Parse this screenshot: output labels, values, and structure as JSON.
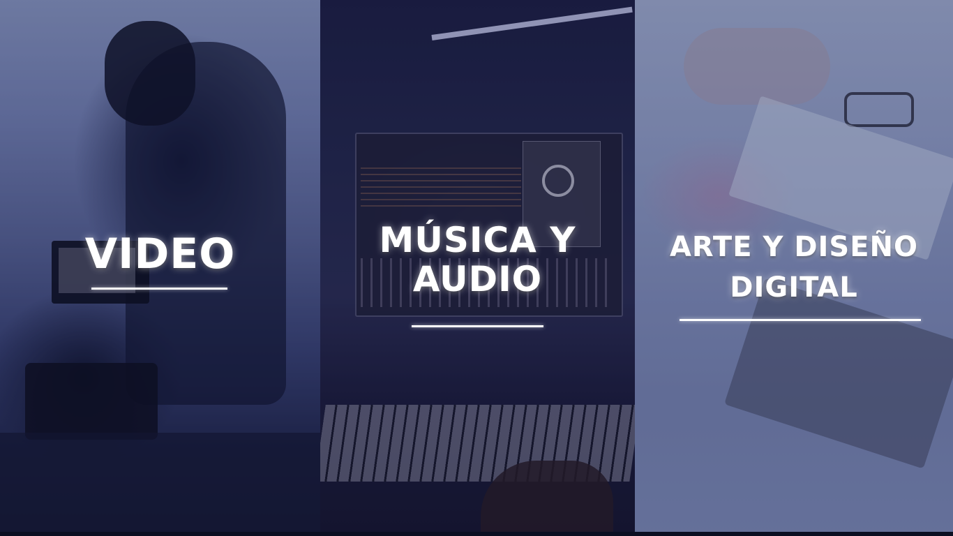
{
  "panels": [
    {
      "id": "video",
      "title_lines": [
        "VIDEO"
      ]
    },
    {
      "id": "musica-audio",
      "title_lines": [
        "MÚSICA Y",
        "AUDIO"
      ]
    },
    {
      "id": "arte-diseno",
      "title_lines": [
        "ARTE Y DISEÑO",
        "DIGITAL"
      ]
    }
  ]
}
